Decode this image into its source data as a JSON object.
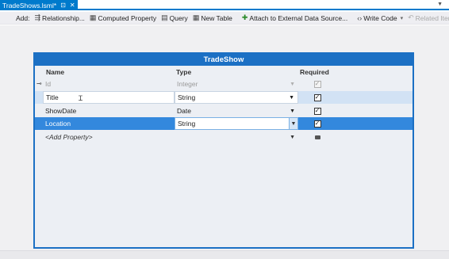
{
  "tab": {
    "title": "TradeShows.lsml*",
    "pin_glyph": "⊡",
    "close_glyph": "✕"
  },
  "toolbar": {
    "add_label": "Add:",
    "buttons": [
      {
        "label": "Relationship...",
        "icon": "relationship-icon"
      },
      {
        "label": "Computed Property",
        "icon": "computed-property-icon"
      },
      {
        "label": "Query",
        "icon": "query-icon"
      },
      {
        "label": "New Table",
        "icon": "table-icon"
      },
      {
        "label": "Attach to External Data Source...",
        "icon": "external-data-icon"
      },
      {
        "label": "Write Code",
        "icon": "code-icon"
      },
      {
        "label": "Related Items",
        "icon": "related-items-icon"
      }
    ]
  },
  "entity": {
    "title": "TradeShow",
    "columns": {
      "name": "Name",
      "type": "Type",
      "required": "Required"
    },
    "rows": [
      {
        "name": "Id",
        "type": "Integer",
        "required": true,
        "key": true
      },
      {
        "name": "Title",
        "type": "String",
        "required": true
      },
      {
        "name": "ShowDate",
        "type": "Date",
        "required": true
      },
      {
        "name": "Location",
        "type": "String",
        "required": true
      }
    ],
    "add_property": "<Add Property>"
  },
  "colors": {
    "accent": "#007acc",
    "entity_border": "#1c70c4",
    "selected_row": "#3388dd"
  }
}
